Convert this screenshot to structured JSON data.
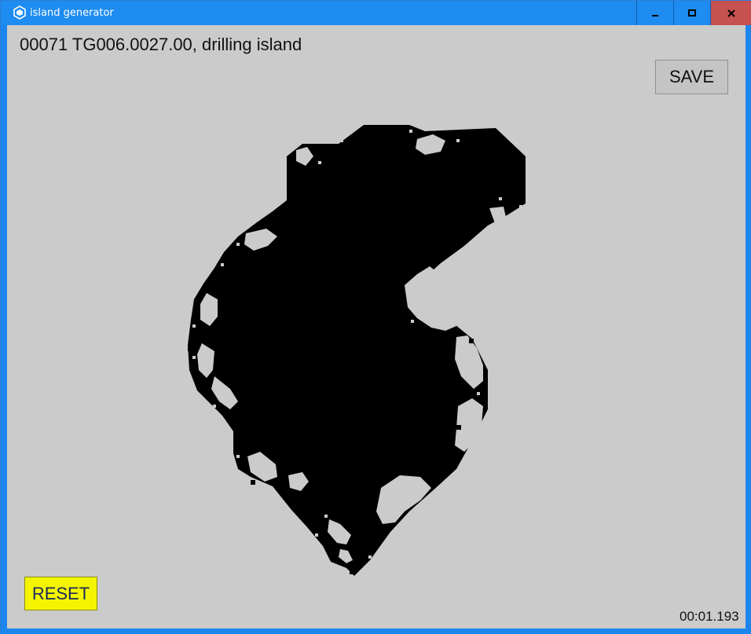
{
  "window": {
    "title": "island generator",
    "icon": "unity-icon",
    "controls": [
      "minimize-icon",
      "maximize-icon",
      "close-icon"
    ]
  },
  "main": {
    "status_line": "00071 TG006.0027.00, drilling island",
    "save_label": "SAVE",
    "reset_label": "RESET",
    "timer": "00:01.193"
  },
  "colors": {
    "titlebar": "#1e8cf0",
    "close": "#c75050",
    "canvas_bg": "#cbcbcb",
    "island": "#000000",
    "reset_button": "#f4f400"
  }
}
